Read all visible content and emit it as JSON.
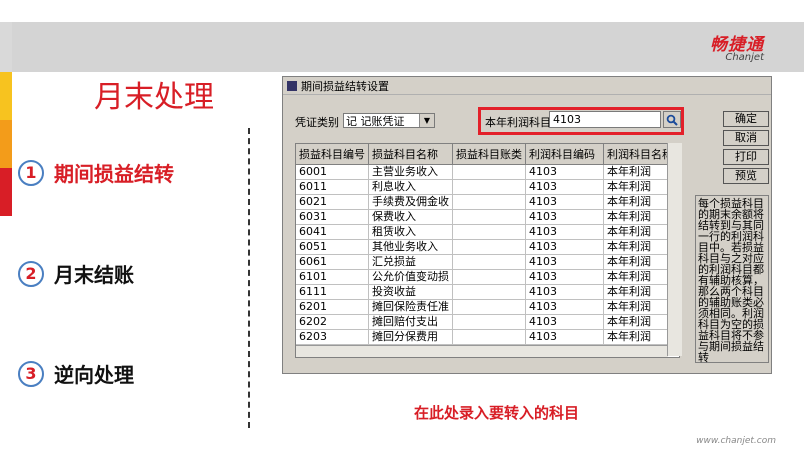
{
  "brand": {
    "name_cn": "畅捷通",
    "name_en": "Chanjet",
    "site": "www.chanjet.com",
    "accent": "#d81e26"
  },
  "page": {
    "title": "月末处理",
    "caption": "在此处录入要转入的科目"
  },
  "menu": [
    {
      "num": "1",
      "label": "期间损益结转",
      "active": true
    },
    {
      "num": "2",
      "label": "月末结账",
      "active": false
    },
    {
      "num": "3",
      "label": "逆向处理",
      "active": false
    }
  ],
  "dialog": {
    "title": "期间损益结转设置",
    "voucher_type_label": "凭证类别",
    "voucher_type_value": "记 记账凭证",
    "profit_account_label": "本年利润科目",
    "profit_account_value": "4103",
    "buttons": {
      "ok": "确定",
      "cancel": "取消",
      "print": "打印",
      "preview": "预览"
    },
    "columns": [
      "损益科目编号",
      "损益科目名称",
      "损益科目账类",
      "利润科目编码",
      "利润科目名称"
    ],
    "rows": [
      [
        "6001",
        "主营业务收入",
        "",
        "4103",
        "本年利润"
      ],
      [
        "6011",
        "利息收入",
        "",
        "4103",
        "本年利润"
      ],
      [
        "6021",
        "手续费及佣金收",
        "",
        "4103",
        "本年利润"
      ],
      [
        "6031",
        "保费收入",
        "",
        "4103",
        "本年利润"
      ],
      [
        "6041",
        "租赁收入",
        "",
        "4103",
        "本年利润"
      ],
      [
        "6051",
        "其他业务收入",
        "",
        "4103",
        "本年利润"
      ],
      [
        "6061",
        "汇兑损益",
        "",
        "4103",
        "本年利润"
      ],
      [
        "6101",
        "公允价值变动损",
        "",
        "4103",
        "本年利润"
      ],
      [
        "6111",
        "投资收益",
        "",
        "4103",
        "本年利润"
      ],
      [
        "6201",
        "摊回保险责任准",
        "",
        "4103",
        "本年利润"
      ],
      [
        "6202",
        "摊回赔付支出",
        "",
        "4103",
        "本年利润"
      ],
      [
        "6203",
        "摊回分保费用",
        "",
        "4103",
        "本年利润"
      ]
    ],
    "note": "每个损益科目的期末余额将结转到与其同一行的利润科目中。若损益科目与之对应的利润科目都有辅助核算，那么两个科目的辅助账类必须相同。利润科目为空的损益科目将不参与期间损益结转"
  }
}
